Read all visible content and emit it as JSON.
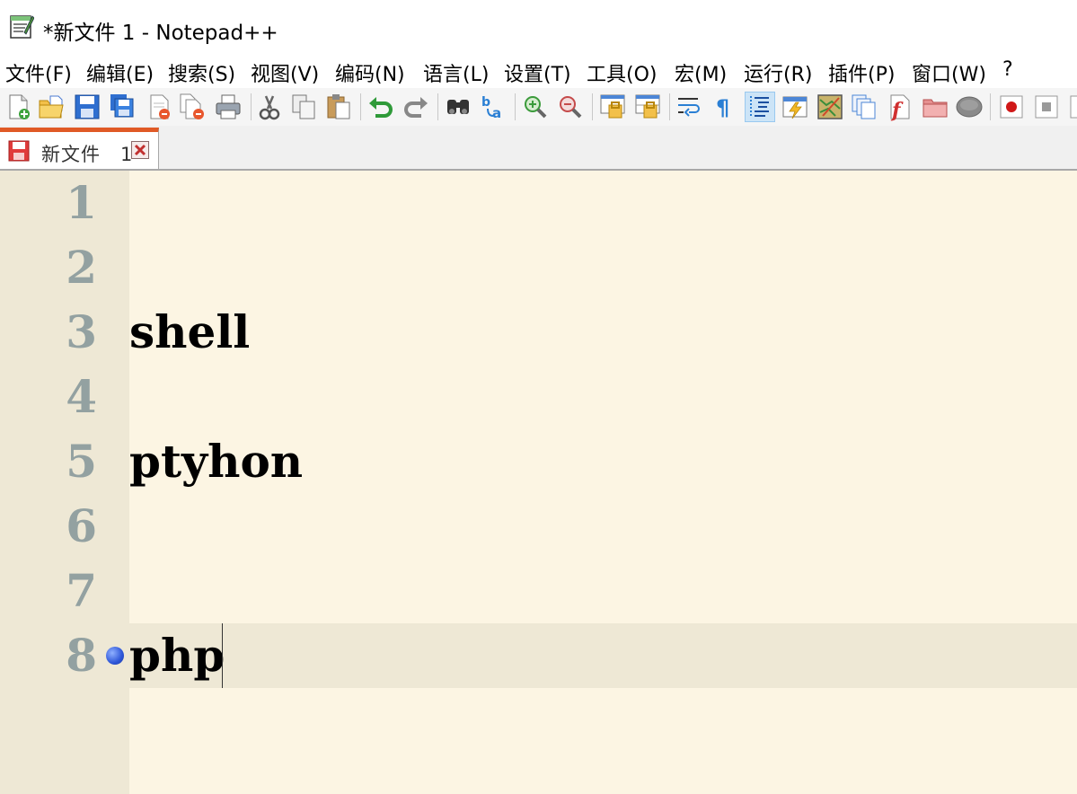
{
  "window": {
    "title": "*新文件 1 - Notepad++"
  },
  "menu": {
    "items": [
      {
        "label": "文件(F)"
      },
      {
        "label": "编辑(E)"
      },
      {
        "label": "搜索(S)"
      },
      {
        "label": "视图(V)"
      },
      {
        "label": "编码(N)"
      },
      {
        "label": "语言(L)"
      },
      {
        "label": "设置(T)"
      },
      {
        "label": "工具(O)"
      },
      {
        "label": "宏(M)"
      },
      {
        "label": "运行(R)"
      },
      {
        "label": "插件(P)"
      },
      {
        "label": "窗口(W)"
      },
      {
        "label": "?"
      }
    ]
  },
  "toolbar": {
    "buttons": [
      {
        "icon": "new-file-icon"
      },
      {
        "icon": "open-file-icon"
      },
      {
        "icon": "save-icon"
      },
      {
        "icon": "save-all-icon"
      },
      {
        "icon": "close-icon"
      },
      {
        "icon": "close-all-icon"
      },
      {
        "icon": "print-icon"
      },
      {
        "icon": "cut-icon"
      },
      {
        "icon": "copy-icon"
      },
      {
        "icon": "paste-icon"
      },
      {
        "icon": "undo-icon"
      },
      {
        "icon": "redo-icon"
      },
      {
        "icon": "find-icon"
      },
      {
        "icon": "replace-icon"
      },
      {
        "icon": "zoom-in-icon"
      },
      {
        "icon": "zoom-out-icon"
      },
      {
        "icon": "sync-vertical-icon"
      },
      {
        "icon": "sync-horizontal-icon"
      },
      {
        "icon": "word-wrap-icon"
      },
      {
        "icon": "show-all-chars-icon"
      },
      {
        "icon": "indent-guide-icon",
        "active": true
      },
      {
        "icon": "user-language-icon"
      },
      {
        "icon": "document-map-icon"
      },
      {
        "icon": "document-list-icon"
      },
      {
        "icon": "function-list-icon"
      },
      {
        "icon": "folder-workspace-icon"
      },
      {
        "icon": "monitoring-icon"
      },
      {
        "icon": "record-macro-icon"
      },
      {
        "icon": "stop-record-icon"
      }
    ]
  },
  "tabs": [
    {
      "label": "新文件",
      "number": "1",
      "modified": true
    }
  ],
  "editor": {
    "lines": [
      {
        "num": "1",
        "text": ""
      },
      {
        "num": "2",
        "text": ""
      },
      {
        "num": "3",
        "text": "shell"
      },
      {
        "num": "4",
        "text": ""
      },
      {
        "num": "5",
        "text": "ptyhon"
      },
      {
        "num": "6",
        "text": ""
      },
      {
        "num": "7",
        "text": ""
      },
      {
        "num": "8",
        "text": "php"
      }
    ],
    "current_line": 8,
    "bookmarked_line": 8
  },
  "colors": {
    "editor_bg": "#fcf5e3",
    "gutter_bg": "#eee8d5",
    "line_number": "#93a1a1",
    "tab_accent": "#e05a26",
    "bookmark": "#2e56d8"
  }
}
